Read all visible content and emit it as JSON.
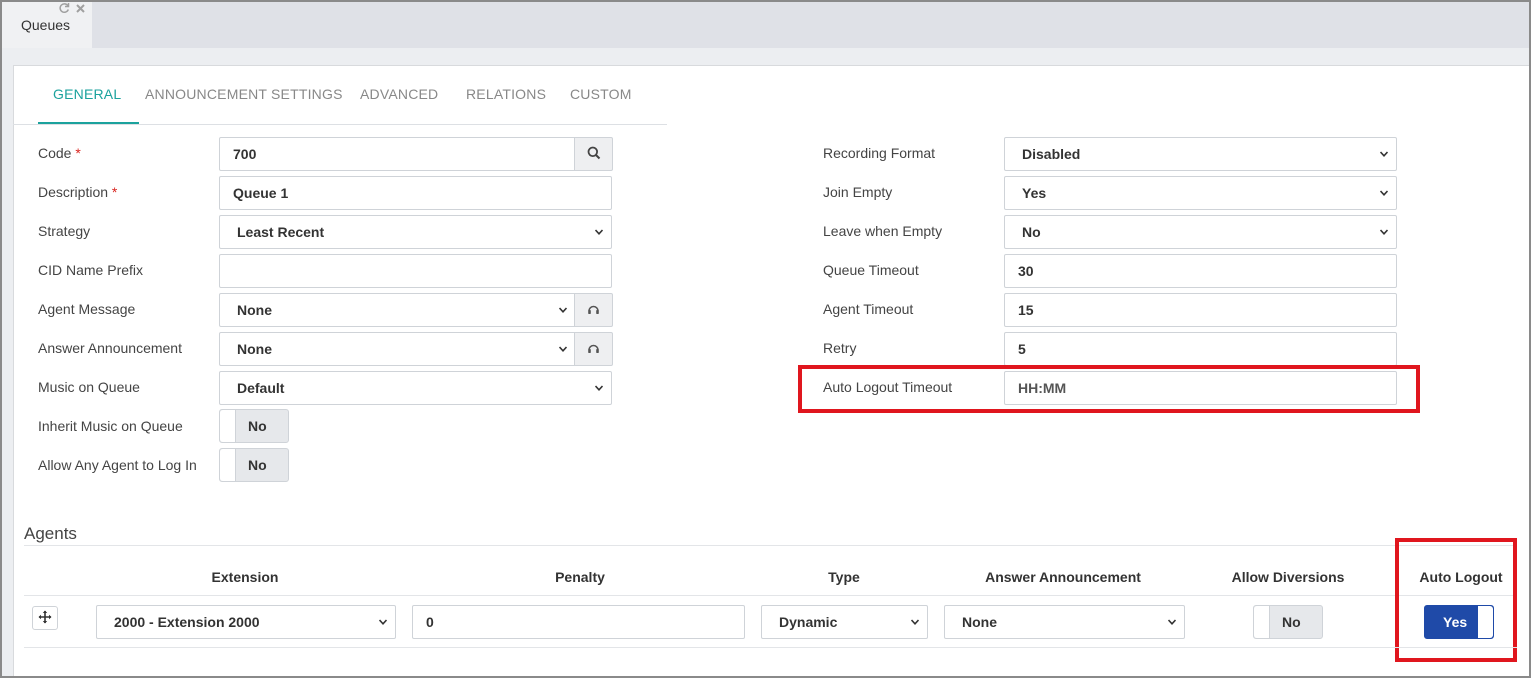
{
  "window": {
    "tab_title": "Queues",
    "refresh_icon": "refresh-icon",
    "close_icon": "close-icon"
  },
  "tabs": [
    "GENERAL",
    "ANNOUNCEMENT SETTINGS",
    "ADVANCED",
    "RELATIONS",
    "CUSTOM"
  ],
  "left": {
    "code": {
      "label": "Code",
      "required": "*",
      "value": "700"
    },
    "description": {
      "label": "Description",
      "required": "*",
      "value": "Queue 1"
    },
    "strategy": {
      "label": "Strategy",
      "value": "Least Recent"
    },
    "cid_prefix": {
      "label": "CID Name Prefix",
      "value": ""
    },
    "agent_message": {
      "label": "Agent Message",
      "value": "None"
    },
    "answer_announcement": {
      "label": "Answer Announcement",
      "value": "None"
    },
    "music_on_queue": {
      "label": "Music on Queue",
      "value": "Default"
    },
    "inherit_music": {
      "label": "Inherit Music on Queue",
      "value": "No"
    },
    "allow_any_agent": {
      "label": "Allow Any Agent to Log In",
      "value": "No"
    }
  },
  "right": {
    "recording_format": {
      "label": "Recording Format",
      "value": "Disabled"
    },
    "join_empty": {
      "label": "Join Empty",
      "value": "Yes"
    },
    "leave_when_empty": {
      "label": "Leave when Empty",
      "value": "No"
    },
    "queue_timeout": {
      "label": "Queue Timeout",
      "value": "30"
    },
    "agent_timeout": {
      "label": "Agent Timeout",
      "value": "15"
    },
    "retry": {
      "label": "Retry",
      "value": "5"
    },
    "auto_logout_timeout": {
      "label": "Auto Logout Timeout",
      "placeholder": "HH:MM"
    }
  },
  "agents": {
    "title": "Agents",
    "columns": [
      "Extension",
      "Penalty",
      "Type",
      "Answer Announcement",
      "Allow Diversions",
      "Auto Logout"
    ],
    "rows": [
      {
        "extension": "2000 - Extension 2000",
        "penalty": "0",
        "type": "Dynamic",
        "answer_announcement": "None",
        "allow_diversions": "No",
        "auto_logout": "Yes"
      }
    ]
  },
  "colors": {
    "accent": "#1ba29d",
    "highlight": "#e0161e",
    "toggle_on": "#1f4aa8",
    "required": "#d9241f"
  }
}
